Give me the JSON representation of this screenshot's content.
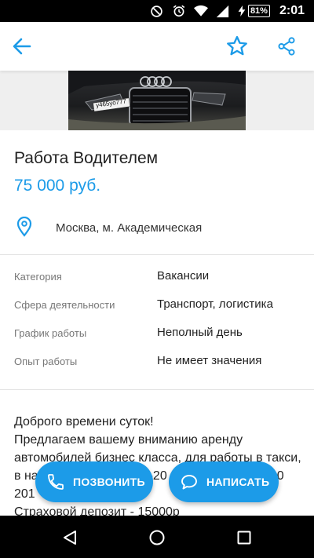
{
  "status_bar": {
    "battery_level": "81%",
    "time": "2:01"
  },
  "toolbar": {
    "back_icon": "arrow-left-icon",
    "favorite_icon": "star-outline-icon",
    "share_icon": "share-icon",
    "accent_color": "#1c9be8"
  },
  "ad": {
    "title": "Работа Водителем",
    "price": "75 000 руб.",
    "location": "Москва, м. Академическая",
    "location_icon": "map-pin-icon",
    "plate_text": "у465уо777"
  },
  "params": [
    {
      "label": "Категория",
      "value": "Вакансии"
    },
    {
      "label": "Сфера деятельности",
      "value": "Транспорт, логистика"
    },
    {
      "label": "График работы",
      "value": "Неполный день"
    },
    {
      "label": "Опыт работы",
      "value": "Не имеет значения"
    }
  ],
  "description": {
    "line1": "Доброго времени суток!",
    "line2": "Предлагаем вашему вниманию аренду",
    "line3": "автомобилей бизнес класса, для работы в такси,",
    "line4": "в на",
    "line4b": "5-20",
    "line4c": "0",
    "line5": "201",
    "line6": "Страховой депозит - 15000р"
  },
  "actions": {
    "call_label": "ПОЗВОНИТЬ",
    "write_label": "НАПИСАТЬ"
  }
}
